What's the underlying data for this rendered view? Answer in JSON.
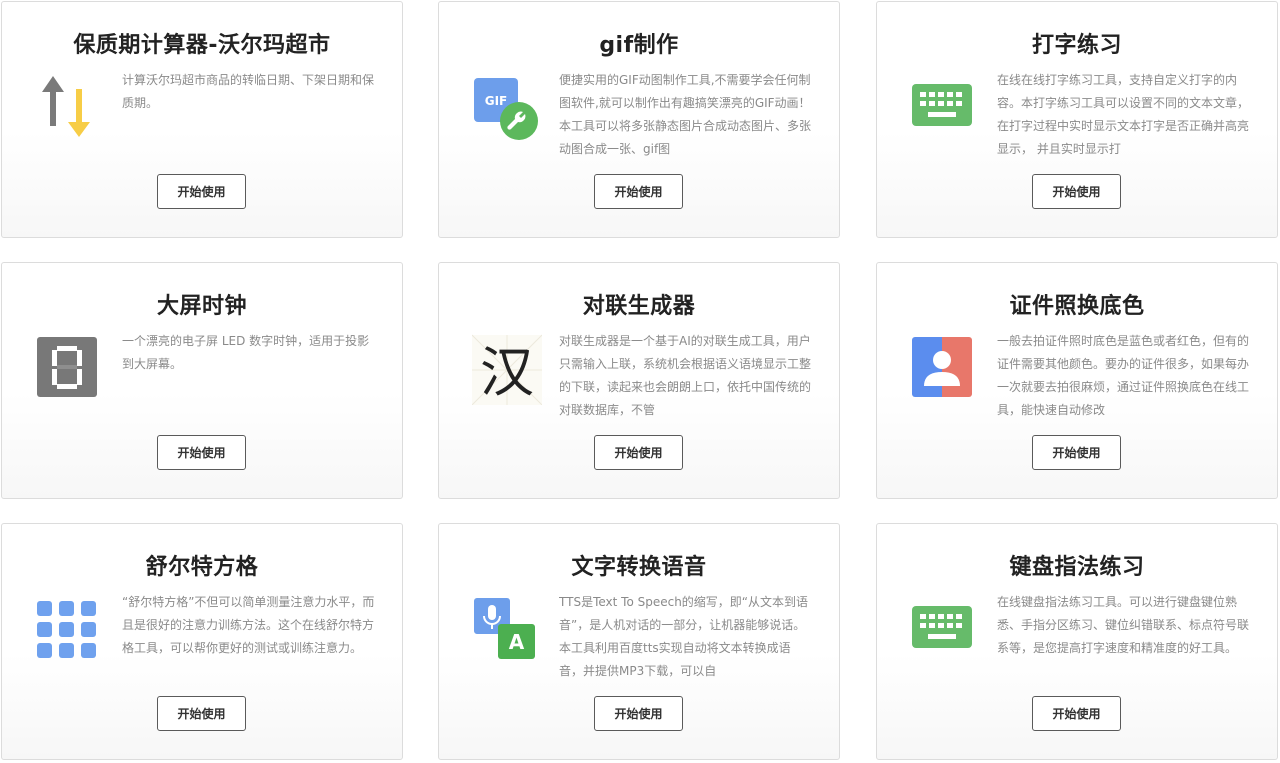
{
  "tools": [
    {
      "title": "保质期计算器-沃尔玛超市",
      "icon": "arrows-up-down-icon",
      "desc": "计算沃尔玛超市商品的转临日期、下架日期和保质期。",
      "button": "开始使用"
    },
    {
      "title": "gif制作",
      "icon": "gif-wrench-icon",
      "icon_text": "GIF",
      "desc": "便捷实用的GIF动图制作工具,不需要学会任何制图软件,就可以制作出有趣搞笑漂亮的GIF动画！本工具可以将多张静态图片合成动态图片、多张动图合成一张、gif图",
      "button": "开始使用"
    },
    {
      "title": "打字练习",
      "icon": "keyboard-icon",
      "desc": "在线在线打字练习工具，支持自定义打字的内容。本打字练习工具可以设置不同的文本文章，在打字过程中实时显示文本打字是否正确并高亮显示， 并且实时显示打",
      "button": "开始使用"
    },
    {
      "title": "大屏时钟",
      "icon": "led-digit-icon",
      "desc": "一个漂亮的电子屏 LED 数字时钟，适用于投影到大屏幕。",
      "button": "开始使用"
    },
    {
      "title": "对联生成器",
      "icon": "han-character-icon",
      "icon_text": "汉",
      "desc": "对联生成器是一个基于AI的对联生成工具，用户只需输入上联，系统机会根据语义语境显示工整的下联，读起来也会朗朗上口，依托中国传统的对联数据库，不管",
      "button": "开始使用"
    },
    {
      "title": "证件照换底色",
      "icon": "id-photo-icon",
      "desc": "一般去拍证件照时底色是蓝色或者红色，但有的证件需要其他颜色。要办的证件很多，如果每办一次就要去拍很麻烦，通过证件照换底色在线工具，能快速自动修改",
      "button": "开始使用"
    },
    {
      "title": "舒尔特方格",
      "icon": "grid-dots-icon",
      "desc": "“舒尔特方格”不但可以简单测量注意力水平，而且是很好的注意力训练方法。这个在线舒尔特方格工具，可以帮你更好的测试或训练注意力。",
      "button": "开始使用"
    },
    {
      "title": "文字转换语音",
      "icon": "mic-translate-icon",
      "icon_text": "A",
      "desc": "TTS是Text To Speech的缩写，即“从文本到语音”，是人机对话的一部分，让机器能够说话。本工具利用百度tts实现自动将文本转换成语音，并提供MP3下载，可以自",
      "button": "开始使用"
    },
    {
      "title": "键盘指法练习",
      "icon": "keyboard-icon",
      "desc": "在线键盘指法练习工具。可以进行键盘键位熟悉、手指分区练习、键位纠错联系、标点符号联系等，是您提高打字速度和精准度的好工具。",
      "button": "开始使用"
    }
  ],
  "colors": {
    "arrow_gray": "#7a7a7a",
    "arrow_yellow": "#f7cd46",
    "gif_blue": "#6d9eeb",
    "wrench_green": "#5cb85c",
    "keyboard_green": "#66bb6a",
    "led_bg": "#787878",
    "id_blue": "#5b8dee",
    "id_red": "#e8776a",
    "grid_blue": "#6fa1ee",
    "mic_blue": "#6d9eeb",
    "translate_green": "#4caf50"
  }
}
